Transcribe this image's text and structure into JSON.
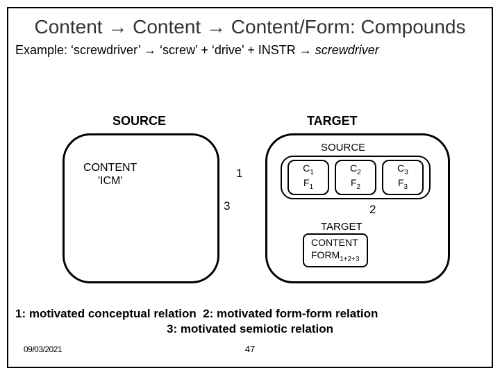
{
  "title": "Content → Content → Content/Form: Compounds",
  "example_prefix": "Example: ",
  "example_body": "‘screwdriver’  →  ‘screw’ + ‘drive’ + INSTR → ",
  "example_result": "screwdriver",
  "source_label": "SOURCE",
  "target_label": "TARGET",
  "content_line1": "CONTENT",
  "content_line2": "'ICM'",
  "num1": "1",
  "num2": "2",
  "num3": "3",
  "inner_source": "SOURCE",
  "inner_target": "TARGET",
  "cf": [
    {
      "c": "C",
      "csub": "1",
      "f": "F",
      "fsub": "1"
    },
    {
      "c": "C",
      "csub": "2",
      "f": "F",
      "fsub": "2"
    },
    {
      "c": "C",
      "csub": "3",
      "f": "F",
      "fsub": "3"
    }
  ],
  "content_form_l1": "CONTENT",
  "content_form_l2": "FORM",
  "content_form_sub": "1+2+3",
  "legend1a": "1: motivated conceptual relation",
  "legend1b": "2: motivated form-form relation",
  "legend2": "3: motivated semiotic relation",
  "footer_date": "09/03/2021",
  "footer_page": "47"
}
